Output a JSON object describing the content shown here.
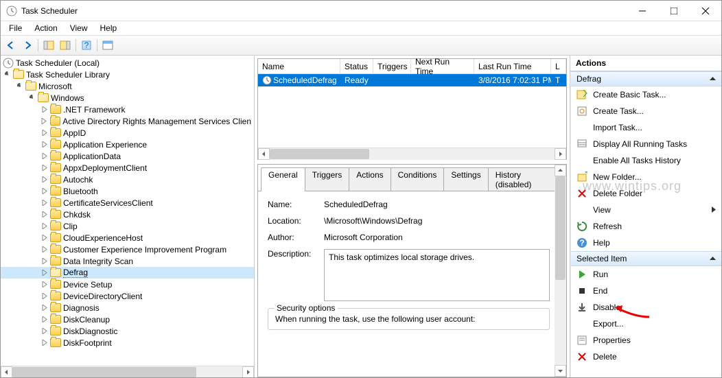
{
  "window": {
    "title": "Task Scheduler"
  },
  "menu": {
    "file": "File",
    "action": "Action",
    "view": "View",
    "help": "Help"
  },
  "tree": {
    "root": "Task Scheduler (Local)",
    "library": "Task Scheduler Library",
    "microsoft": "Microsoft",
    "windows": "Windows",
    "selected": "Defrag",
    "items": [
      ".NET Framework",
      "Active Directory Rights Management Services Clien",
      "AppID",
      "Application Experience",
      "ApplicationData",
      "AppxDeploymentClient",
      "Autochk",
      "Bluetooth",
      "CertificateServicesClient",
      "Chkdsk",
      "Clip",
      "CloudExperienceHost",
      "Customer Experience Improvement Program",
      "Data Integrity Scan",
      "Defrag",
      "Device Setup",
      "DeviceDirectoryClient",
      "Diagnosis",
      "DiskCleanup",
      "DiskDiagnostic",
      "DiskFootprint"
    ]
  },
  "task_list": {
    "headers": {
      "name": "Name",
      "status": "Status",
      "triggers": "Triggers",
      "next_run": "Next Run Time",
      "last_run": "Last Run Time",
      "last_result": "L"
    },
    "row": {
      "name": "ScheduledDefrag",
      "status": "Ready",
      "triggers": "",
      "next_run": "",
      "last_run": "3/8/2016 7:02:31 PM",
      "last_result": "T"
    }
  },
  "tabs": {
    "general": "General",
    "triggers": "Triggers",
    "actions": "Actions",
    "conditions": "Conditions",
    "settings": "Settings",
    "history": "History (disabled)"
  },
  "details": {
    "name_label": "Name:",
    "name_value": "ScheduledDefrag",
    "location_label": "Location:",
    "location_value": "\\Microsoft\\Windows\\Defrag",
    "author_label": "Author:",
    "author_value": "Microsoft Corporation",
    "description_label": "Description:",
    "description_value": "This task optimizes local storage drives.",
    "security_legend": "Security options",
    "security_text": "When running the task, use the following user account:"
  },
  "actions_panel": {
    "title": "Actions",
    "group1_title": "Defrag",
    "group1": [
      "Create Basic Task...",
      "Create Task...",
      "Import Task...",
      "Display All Running Tasks",
      "Enable All Tasks History",
      "New Folder...",
      "Delete Folder",
      "View",
      "Refresh",
      "Help"
    ],
    "group2_title": "Selected Item",
    "group2": [
      "Run",
      "End",
      "Disable",
      "Export...",
      "Properties",
      "Delete"
    ]
  },
  "watermark": "www.wintips.org"
}
